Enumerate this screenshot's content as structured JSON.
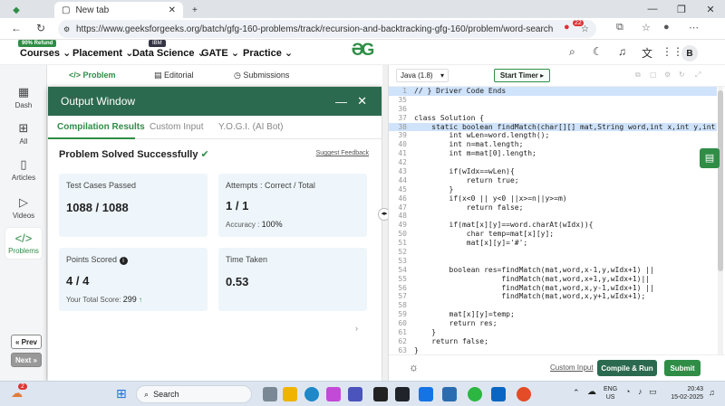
{
  "browser": {
    "tab_title": "New tab",
    "url": "https://www.geeksforgeeks.org/batch/gfg-160-problems/track/recursion-and-backtracking-gfg-160/problem/word-search",
    "ext_badge": "22"
  },
  "sitenav": {
    "courses": "Courses",
    "courses_badge": "90% Refund",
    "placement": "Placement",
    "data_science": "Data Science",
    "data_science_badge": "IBM",
    "gate": "GATE",
    "practice": "Practice",
    "logo": "GfG",
    "avatar": "B"
  },
  "sidebar": {
    "items": [
      {
        "label": "Dash",
        "icon": "dashboard-icon"
      },
      {
        "label": "All",
        "icon": "grid-icon"
      },
      {
        "label": "Articles",
        "icon": "book-icon"
      },
      {
        "label": "Videos",
        "icon": "video-icon"
      },
      {
        "label": "Problems",
        "icon": "code-icon"
      }
    ],
    "prev": "« Prev",
    "next": "Next »"
  },
  "problem_tabs": {
    "problem": "Problem",
    "editorial": "Editorial",
    "submissions": "Submissions"
  },
  "output": {
    "title": "Output Window",
    "tabs": [
      "Compilation Results",
      "Custom Input",
      "Y.O.G.I. (AI Bot)"
    ],
    "status": "Problem Solved Successfully",
    "feedback": "Suggest Feedback",
    "test_label": "Test Cases Passed",
    "test_value": "1088 / 1088",
    "attempts_label": "Attempts : Correct / Total",
    "attempts_value": "1 / 1",
    "accuracy_label": "Accuracy :",
    "accuracy_value": "100%",
    "points_label": "Points Scored",
    "points_value": "4 / 4",
    "total_label": "Your Total Score:",
    "total_value": "299",
    "time_label": "Time Taken",
    "time_value": "0.53"
  },
  "editor": {
    "language": "Java (1.8)",
    "timer": "Start Timer",
    "custom_input": "Custom Input",
    "compile_run": "Compile & Run",
    "submit": "Submit",
    "lines": [
      {
        "n": "1",
        "t": "// } Driver Code Ends",
        "hl": true
      },
      {
        "n": "35",
        "t": ""
      },
      {
        "n": "36",
        "t": ""
      },
      {
        "n": "37",
        "t": "class Solution {"
      },
      {
        "n": "38",
        "t": "    static boolean findMatch(char[][] mat,String word,int x,int y,int wIdx){",
        "hl": true
      },
      {
        "n": "39",
        "t": "        int wLen=word.length();"
      },
      {
        "n": "40",
        "t": "        int n=mat.length;"
      },
      {
        "n": "41",
        "t": "        int m=mat[0].length;"
      },
      {
        "n": "42",
        "t": ""
      },
      {
        "n": "43",
        "t": "        if(wIdx==wLen){"
      },
      {
        "n": "44",
        "t": "            return true;"
      },
      {
        "n": "45",
        "t": "        }"
      },
      {
        "n": "46",
        "t": "        if(x<0 || y<0 ||x>=n||y>=m)"
      },
      {
        "n": "47",
        "t": "            return false;"
      },
      {
        "n": "48",
        "t": ""
      },
      {
        "n": "49",
        "t": "        if(mat[x][y]==word.charAt(wIdx)){"
      },
      {
        "n": "50",
        "t": "            char temp=mat[x][y];"
      },
      {
        "n": "51",
        "t": "            mat[x][y]='#';"
      },
      {
        "n": "52",
        "t": ""
      },
      {
        "n": "53",
        "t": ""
      },
      {
        "n": "54",
        "t": "        boolean res=findMatch(mat,word,x-1,y,wIdx+1) ||"
      },
      {
        "n": "55",
        "t": "                    findMatch(mat,word,x+1,y,wIdx+1)||"
      },
      {
        "n": "56",
        "t": "                    findMatch(mat,word,x,y-1,wIdx+1) ||"
      },
      {
        "n": "57",
        "t": "                    findMatch(mat,word,x,y+1,wIdx+1);"
      },
      {
        "n": "58",
        "t": ""
      },
      {
        "n": "59",
        "t": "        mat[x][y]=temp;"
      },
      {
        "n": "60",
        "t": "        return res;"
      },
      {
        "n": "61",
        "t": "    }"
      },
      {
        "n": "62",
        "t": "    return false;"
      },
      {
        "n": "63",
        "t": "}"
      }
    ]
  },
  "taskbar": {
    "search": "Search",
    "weather_badge": "2",
    "lang1": "ENG",
    "lang2": "US",
    "time": "20:43",
    "date": "15-02-2025"
  },
  "colors": {
    "accent": "#2f8d46",
    "output_header": "#2c6a4f",
    "card_bg": "#eef6fb"
  }
}
